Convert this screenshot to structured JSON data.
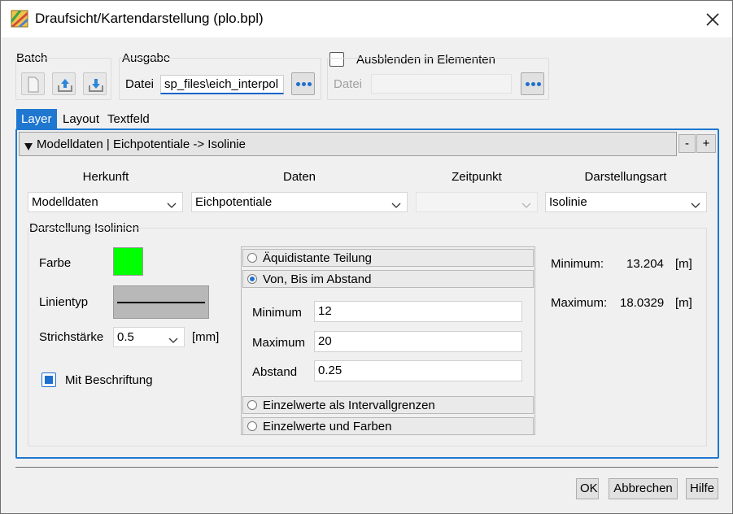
{
  "window": {
    "title": "Draufsicht/Kartendarstellung (plo.bpl)",
    "app_icon": "layers-map-icon",
    "close_icon": "close-icon"
  },
  "batch": {
    "label": "Batch",
    "buttons": [
      "new-file-icon",
      "upload-icon",
      "download-icon"
    ]
  },
  "ausgabe": {
    "label": "Ausgabe",
    "file_label": "Datei",
    "file_value": "sp_files\\eich_interpol",
    "browse_icon": "ellipsis-icon"
  },
  "ausblenden": {
    "checkbox_label": "Ausblenden in Elementen",
    "checked": false,
    "file_label": "Datei",
    "file_value": ""
  },
  "tabs": [
    {
      "label": "Layer",
      "active": true
    },
    {
      "label": "Layout",
      "active": false
    },
    {
      "label": "Textfeld",
      "active": false
    }
  ],
  "layer_header": {
    "title": "Modelldaten | Eichpotentiale -> Isolinie",
    "minus": "-",
    "plus": "+"
  },
  "columns": {
    "herkunft": {
      "label": "Herkunft",
      "value": "Modelldaten"
    },
    "daten": {
      "label": "Daten",
      "value": "Eichpotentiale"
    },
    "zeitpunkt": {
      "label": "Zeitpunkt",
      "value": ""
    },
    "darstellungsart": {
      "label": "Darstellungsart",
      "value": "Isolinie"
    }
  },
  "isolinien": {
    "group_label": "Darstellung Isolinien",
    "farbe_label": "Farbe",
    "farbe_color": "#00ff00",
    "linientyp_label": "Linientyp",
    "strichstaerke_label": "Strichstärke",
    "strichstaerke_value": "0.5",
    "strichstaerke_unit": "[mm]",
    "beschriftung_label": "Mit Beschriftung",
    "beschriftung_checked": true
  },
  "teilung": {
    "options": [
      {
        "label": "Äquidistante Teilung",
        "selected": false
      },
      {
        "label": "Von, Bis im Abstand",
        "selected": true
      },
      {
        "label": "Einzelwerte als Intervallgrenzen",
        "selected": false
      },
      {
        "label": "Einzelwerte und Farben",
        "selected": false
      }
    ],
    "minimum_label": "Minimum",
    "minimum_value": "12",
    "maximum_label": "Maximum",
    "maximum_value": "20",
    "abstand_label": "Abstand",
    "abstand_value": "0.25"
  },
  "range": {
    "minimum_label": "Minimum:",
    "minimum_value": "13.204",
    "minimum_unit": "[m]",
    "maximum_label": "Maximum:",
    "maximum_value": "18.0329",
    "maximum_unit": "[m]"
  },
  "buttons": {
    "ok": "OK",
    "cancel": "Abbrechen",
    "help": "Hilfe"
  },
  "colors": {
    "accent": "#1f77d0",
    "panel_border": "#1f77d0"
  }
}
